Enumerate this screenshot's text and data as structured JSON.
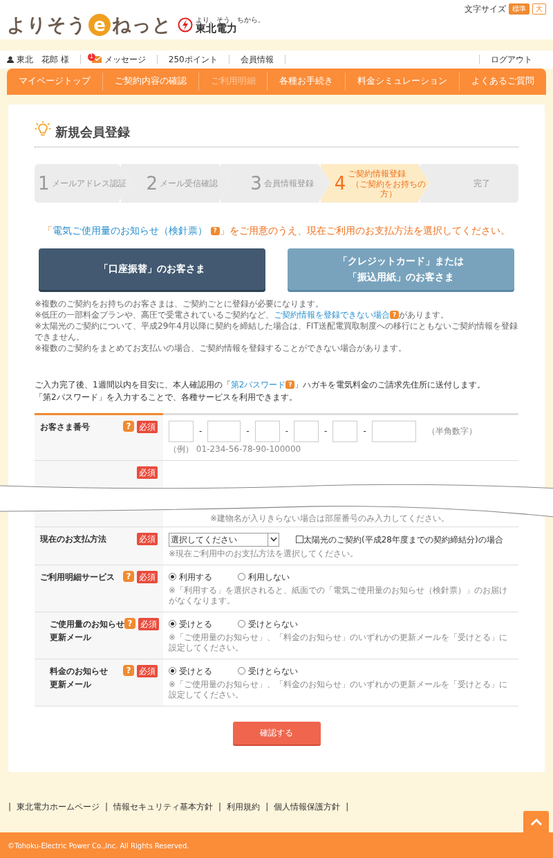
{
  "header": {
    "logo": [
      "よりそう",
      "e",
      "ねっと"
    ],
    "company_tagline": "より、そう、ちから。",
    "company_name": "東北電力",
    "font_size_label": "文字サイズ",
    "font_sizes": [
      {
        "label": "標準",
        "selected": true
      },
      {
        "label": "大",
        "selected": false
      }
    ]
  },
  "user_bar": {
    "user": "東北　花郎 様",
    "message_count": "1",
    "messages": "メッセージ",
    "points": "250ポイント",
    "member_info": "会員情報",
    "logout": "ログアウト"
  },
  "nav": [
    {
      "label": "マイページトップ",
      "disabled": false
    },
    {
      "label": "ご契約内容の確認",
      "disabled": false
    },
    {
      "label": "ご利用明細",
      "disabled": true
    },
    {
      "label": "各種お手続き",
      "disabled": false
    },
    {
      "label": "料金シミュレーション",
      "disabled": false
    },
    {
      "label": "よくあるご質問",
      "disabled": false
    }
  ],
  "page_title": "新規会員登録",
  "steps": [
    {
      "number": "1",
      "label": "メールアドレス認証",
      "selected": false
    },
    {
      "number": "2",
      "label": "メール受信確認",
      "selected": false
    },
    {
      "number": "3",
      "label": "会員情報登録",
      "selected": false
    },
    {
      "number": "4",
      "label": "ご契約情報登録",
      "sub": "（ご契約をお持ちの方）",
      "selected": true
    },
    {
      "label": "完了",
      "selected": false
    }
  ],
  "instruction": {
    "open": "「",
    "link": "電気ご使用量のお知らせ（検針票）",
    "help": "?",
    "rest": "」をご用意のうえ、現在ご利用のお支払方法を選択してください。"
  },
  "payment_buttons": [
    {
      "lines": [
        "「口座振替」のお客さま"
      ],
      "selected": true
    },
    {
      "lines": [
        "「クレジットカード」または",
        "「振込用紙」のお客さま"
      ],
      "selected": false
    }
  ],
  "notes": [
    {
      "text": "※複数のご契約をお持ちのお客さまは、ご契約ごとに登録が必要になります。"
    },
    {
      "text": "※低圧の一部料金プランや、高圧で受電されているご契約など、",
      "link": "ご契約情報を登録できない場合",
      "help": "?",
      "after": "があります。"
    },
    {
      "text": "※太陽光のご契約について、平成29年4月以降に契約を締結した場合は、FIT送配電買取制度への移行にともないご契約情報を登録できません。"
    },
    {
      "text": "※複数のご契約をまとめてお支払いの場合、ご契約情報を登録することができない場合があります。"
    }
  ],
  "intro": {
    "before": "ご入力完了後、1週間以内を目安に、本人確認用の「",
    "link": "第2パスワード",
    "help": "?",
    "after": "」ハガキを電気料金のご請求先住所に送付します。",
    "line2": "「第2パスワード」を入力することで、各種サービスを利用できます。"
  },
  "form_rows": [
    {
      "kind": "customer_number",
      "label": [
        "お客さま番号"
      ],
      "help": "?",
      "required": "必須",
      "separators": [
        "-",
        "-",
        "-",
        "-",
        "-"
      ],
      "hint": "（半角数字）",
      "example": "（例） 01-234-56-78-90-100000"
    },
    {
      "kind": "torn",
      "required": "必須",
      "note": "※建物名が入りきらない場合は部屋番号のみ入力してください。"
    },
    {
      "kind": "select",
      "label": [
        "現在のお支払方法"
      ],
      "required": "必須",
      "value": "選択してください",
      "checkbox": {
        "label": "太陽光のご契約(平成28年度までの契約締結分)の場合",
        "checked": false
      },
      "note": "※現在ご利用中のお支払方法を選択してください。"
    },
    {
      "kind": "radio",
      "label": [
        "ご利用明細サービス"
      ],
      "help": "?",
      "required": "必須",
      "options": [
        {
          "label": "利用する",
          "selected": true
        },
        {
          "label": "利用しない",
          "selected": false
        }
      ],
      "note": "※「利用する」を選択されると、紙面での「電気ご使用量のお知らせ（検針票）」のお届けがなくなります。"
    },
    {
      "kind": "radio",
      "sub": true,
      "label": [
        "ご使用量のお知らせ",
        "更新メール"
      ],
      "help": "?",
      "required": "必須",
      "options": [
        {
          "label": "受けとる",
          "selected": true
        },
        {
          "label": "受けとらない",
          "selected": false
        }
      ],
      "note": "※「ご使用量のお知らせ」、「料金のお知らせ」のいずれかの更新メールを「受けとる」に設定してください。"
    },
    {
      "kind": "radio",
      "sub": true,
      "label": [
        "料金のお知らせ",
        "更新メール"
      ],
      "help": "?",
      "required": "必須",
      "options": [
        {
          "label": "受けとる",
          "selected": true
        },
        {
          "label": "受けとらない",
          "selected": false
        }
      ],
      "note": "※「ご使用量のお知らせ」、「料金のお知らせ」のいずれかの更新メールを「受けとる」に設定してください。"
    }
  ],
  "submit": "確認する",
  "footer_links": [
    "東北電力ホームページ",
    "情報セキュリティ基本方針",
    "利用規約",
    "個人情報保護方針"
  ],
  "footer_separators": [
    "|",
    "|",
    "|",
    "|",
    "|"
  ],
  "copyright": "©Tohoku-Electric Power Co.,Inc. All Rights Reserved."
}
